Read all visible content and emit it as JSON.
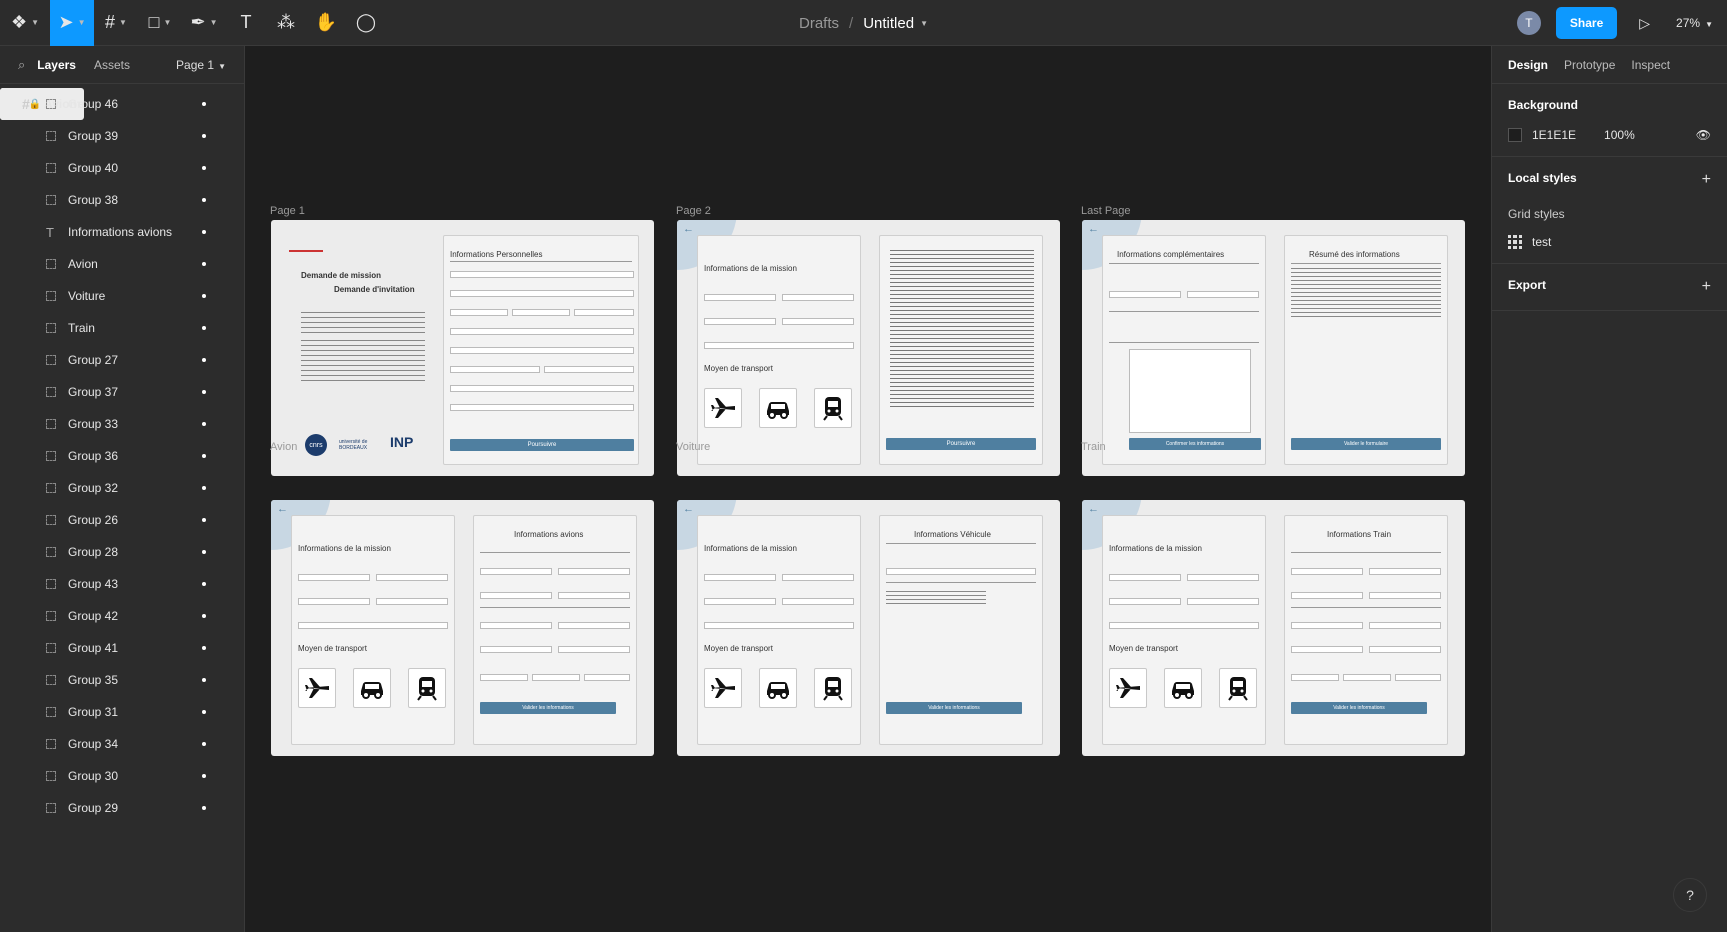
{
  "toolbar": {
    "title_drafts": "Drafts",
    "title_sep": "/",
    "title_file": "Untitled",
    "avatar_initial": "T",
    "share_label": "Share",
    "zoom": "27%"
  },
  "left_panel": {
    "tab_layers": "Layers",
    "tab_assets": "Assets",
    "page_selector": "Page 1",
    "frames": [
      "Train",
      "Voiture",
      "Avion"
    ],
    "groups": [
      "Group 46",
      "Group 39",
      "Group 40",
      "Group 38",
      "Informations avions",
      "Avion",
      "Voiture",
      "Train",
      "Group 27",
      "Group 37",
      "Group 33",
      "Group 36",
      "Group 32",
      "Group 26",
      "Group 28",
      "Group 43",
      "Group 42",
      "Group 41",
      "Group 35",
      "Group 31",
      "Group 34",
      "Group 30",
      "Group 29"
    ]
  },
  "right_panel": {
    "tab_design": "Design",
    "tab_prototype": "Prototype",
    "tab_inspect": "Inspect",
    "background_title": "Background",
    "background_hex": "1E1E1E",
    "background_opacity": "100%",
    "local_styles_title": "Local styles",
    "grid_styles_label": "Grid styles",
    "grid_style_name": "test",
    "export_title": "Export"
  },
  "canvas": {
    "frame_labels": [
      "Page 1",
      "Page 2",
      "Last Page",
      "Avion",
      "Voiture",
      "Train"
    ],
    "page1": {
      "heading1": "Demande de mission",
      "heading2": "Demande d'invitation",
      "form_title": "Informations Personnelles",
      "button": "Poursuivre",
      "logo_cnrs": "cnrs",
      "logo_univ": "université de BORDEAUX",
      "logo_inp": "INP"
    },
    "page2": {
      "mission_title": "Informations de la mission",
      "transport_title": "Moyen de transport",
      "button": "Poursuivre"
    },
    "last_page": {
      "left_title": "Informations complémentaires",
      "right_title": "Résumé des informations",
      "left_button": "Confirmer les informations",
      "right_button": "Valider le formulaire"
    },
    "avion": {
      "mission_title": "Informations de la mission",
      "transport_title": "Moyen de transport",
      "right_title": "Informations avions",
      "button": "Valider les informations"
    },
    "voiture": {
      "mission_title": "Informations de la mission",
      "transport_title": "Moyen de transport",
      "right_title": "Informations Véhicule",
      "button": "Valider les informations"
    },
    "train": {
      "mission_title": "Informations de la mission",
      "transport_title": "Moyen de transport",
      "right_title": "Informations Train",
      "button": "Valider les informations"
    }
  },
  "colors": {
    "accent": "#0d99ff",
    "canvas_bg": "#1e1e1e",
    "panel_bg": "#2c2c2c",
    "form_button": "#4f7fa0"
  }
}
